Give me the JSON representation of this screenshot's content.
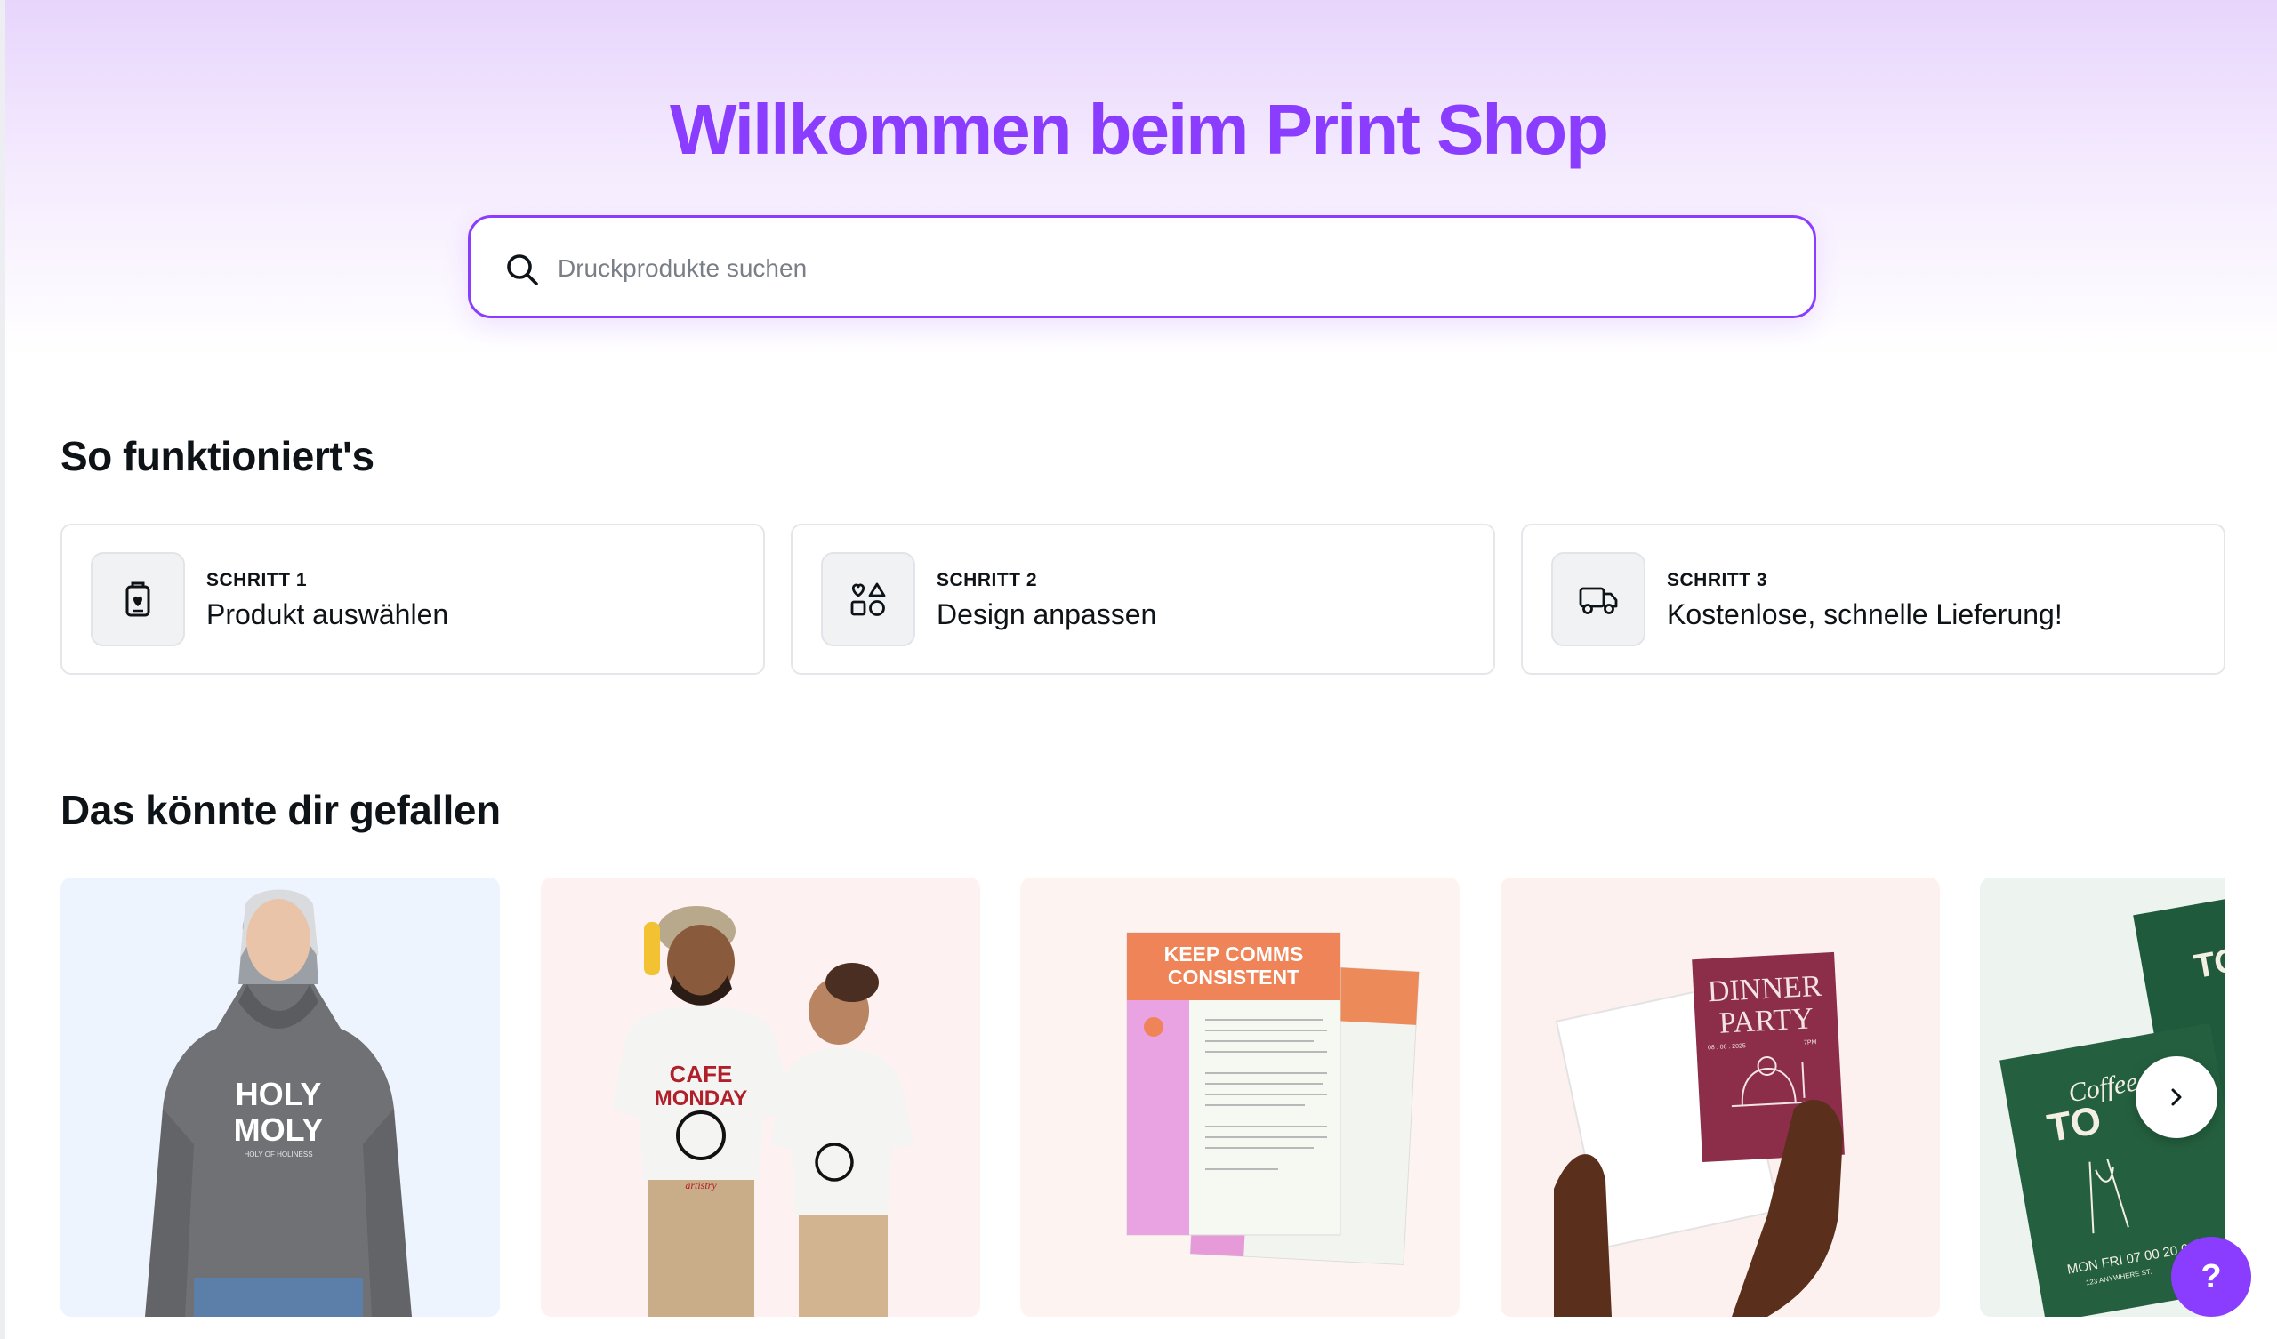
{
  "header": {
    "title": "Willkommen beim Print Shop"
  },
  "search": {
    "placeholder": "Druckprodukte suchen",
    "value": ""
  },
  "how_it_works": {
    "title": "So funktioniert's",
    "steps": [
      {
        "kicker": "SCHRITT 1",
        "label": "Produkt auswählen",
        "icon": "product-card-icon"
      },
      {
        "kicker": "SCHRITT 2",
        "label": "Design anpassen",
        "icon": "shapes-icon"
      },
      {
        "kicker": "SCHRITT 3",
        "label": "Kostenlose, schnelle Lieferung!",
        "icon": "truck-icon"
      }
    ]
  },
  "recommendations": {
    "title": "Das könnte dir gefallen",
    "products": [
      {
        "name": "hoodie",
        "print_line1": "HOLY",
        "print_line2": "MOLY",
        "print_small": "HOLY OF HOLINESS",
        "background": "#eef4fd"
      },
      {
        "name": "t-shirts",
        "print_line1": "CAFE",
        "print_line2": "MONDAY",
        "print_brand": "artistry",
        "background": "#fdf2f1"
      },
      {
        "name": "letterhead",
        "heading_line1": "KEEP COMMS",
        "heading_line2": "CONSISTENT",
        "background": "#fdf4f2"
      },
      {
        "name": "invitation-card",
        "heading_line1": "DINNER",
        "heading_line2": "PARTY",
        "date": "08 . 06 . 2025",
        "time": "7PM",
        "background": "#fdf1ef"
      },
      {
        "name": "coffee-flyer",
        "script": "Coffee",
        "heading": "TO",
        "hours": "MON FRI 07 00 20 00",
        "address": "123 ANYWHERE ST.",
        "background": "#edf4f0"
      }
    ]
  },
  "carousel": {
    "next_icon": "chevron-right-icon"
  },
  "help": {
    "label": "?"
  },
  "colors": {
    "accent": "#8b3dff",
    "text": "#0e1318",
    "border": "#e4e6ea"
  }
}
